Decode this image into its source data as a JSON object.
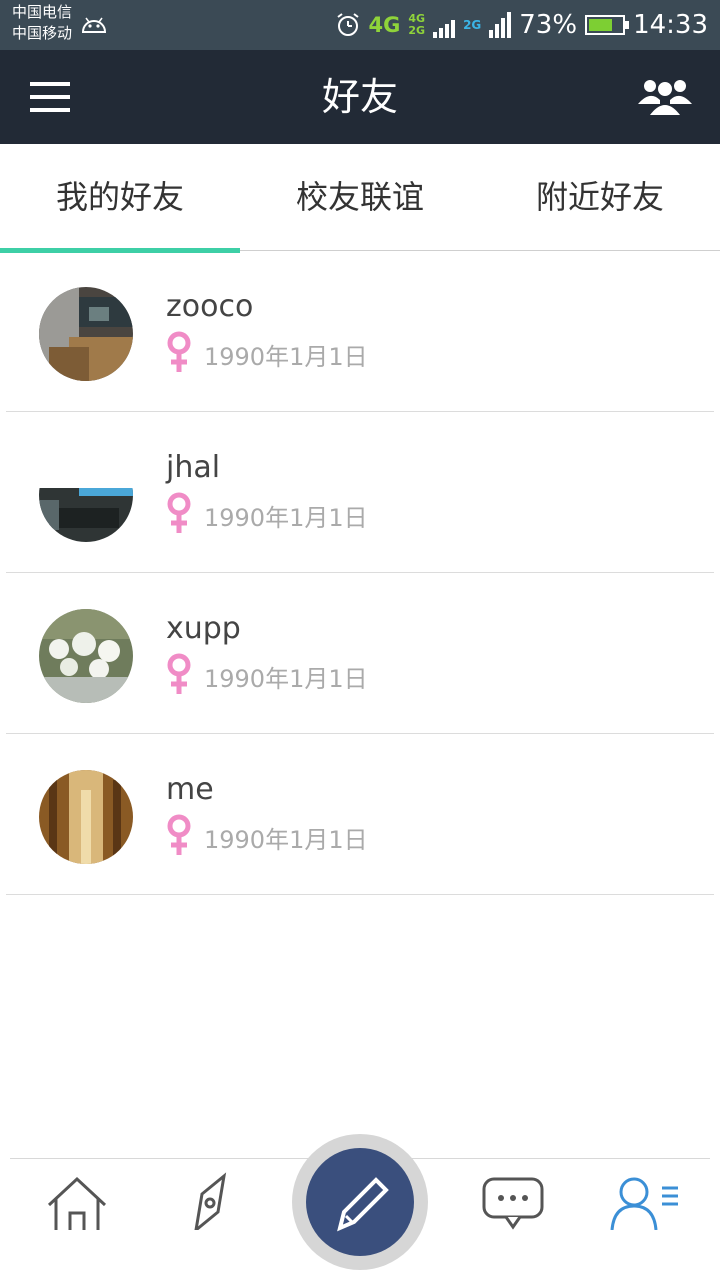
{
  "status_bar": {
    "carrier1": "中国电信",
    "carrier2": "中国移动",
    "net1": "4G",
    "net2a": "4G",
    "net2b": "2G",
    "net3": "2G",
    "battery": "73%",
    "battery_level": 0.73,
    "time": "14:33"
  },
  "appbar": {
    "title": "好友"
  },
  "tabs": [
    {
      "label": "我的好友",
      "active": true
    },
    {
      "label": "校友联谊",
      "active": false
    },
    {
      "label": "附近好友",
      "active": false
    }
  ],
  "friends": [
    {
      "name": "zooco",
      "birthday": "1990年1月1日",
      "gender_icon": "female-icon"
    },
    {
      "name": "jhal",
      "birthday": "1990年1月1日",
      "gender_icon": "female-icon"
    },
    {
      "name": "xupp",
      "birthday": "1990年1月1日",
      "gender_icon": "female-icon"
    },
    {
      "name": "me",
      "birthday": "1990年1月1日",
      "gender_icon": "female-icon"
    }
  ],
  "colors": {
    "accent": "#3dcfa6",
    "appbar": "#222a36",
    "female": "#f08cc6"
  },
  "bottom_nav_icons": [
    "home-icon",
    "compass-icon",
    "compose-icon",
    "chat-icon",
    "contacts-icon"
  ]
}
